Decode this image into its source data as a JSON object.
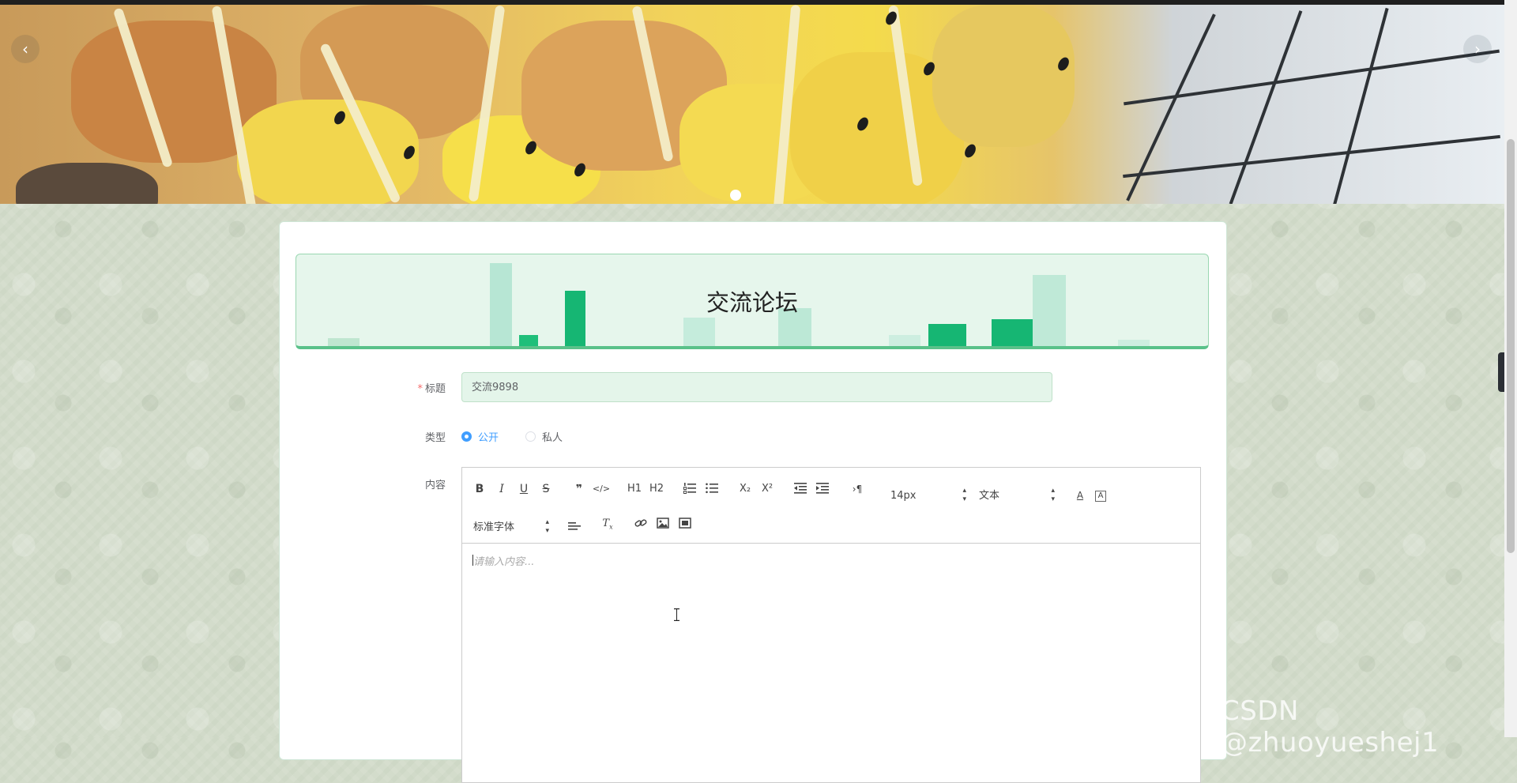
{
  "carousel": {
    "prev_icon": "‹",
    "next_icon": "›"
  },
  "forum": {
    "title": "交流论坛"
  },
  "form": {
    "title_label": "标题",
    "title_required_mark": "*",
    "title_value": "交流9898",
    "type_label": "类型",
    "type_options": [
      "公开",
      "私人"
    ],
    "type_selected": "公开",
    "content_label": "内容"
  },
  "editor": {
    "toolbar_row1": [
      "B",
      "I",
      "U",
      "S",
      "❞",
      "</>",
      "H1",
      "H2",
      "ordered-list",
      "bullet-list",
      "X₂",
      "X²",
      "outdent",
      "indent",
      "rtl"
    ],
    "font_size": "14px",
    "header_select": "文本",
    "font_family": "标准字体",
    "placeholder": "请输入内容...",
    "accent_colors": {
      "text_color_icon": "#444444"
    }
  },
  "side_tab": {
    "icon": "‹"
  },
  "watermark": "CSDN @zhuoyueshej1"
}
